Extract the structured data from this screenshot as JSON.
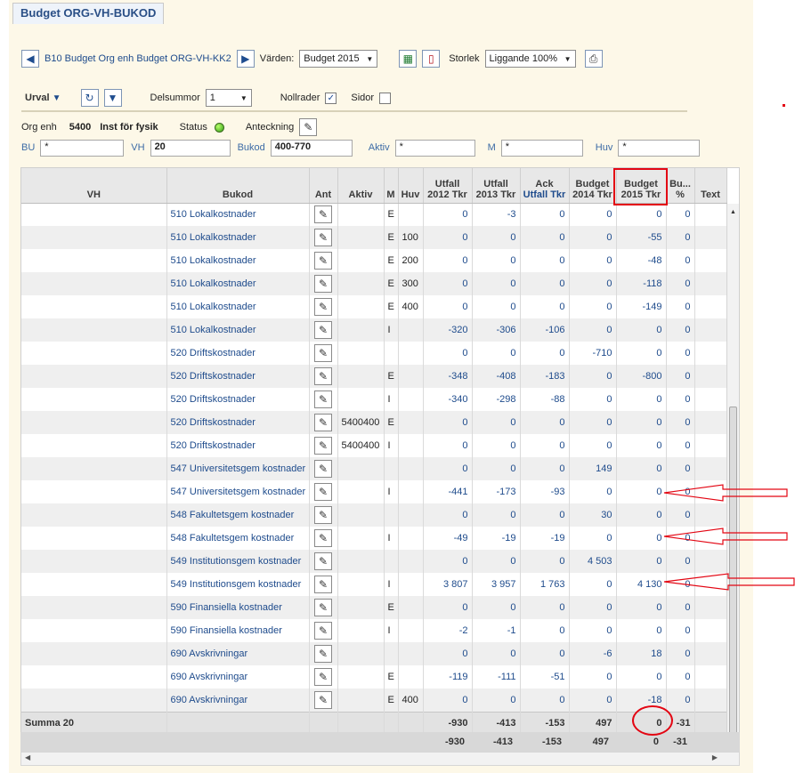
{
  "window": {
    "title": "Budget ORG-VH-BUKOD"
  },
  "toolbar": {
    "breadcrumb": "B10 Budget Org enh  Budget ORG-VH-KK2",
    "values_label": "Värden:",
    "values_selected": "Budget 2015",
    "size_label": "Storlek",
    "size_selected": "Liggande 100%",
    "urval_label": "Urval",
    "delsummor_label": "Delsummor",
    "delsummor_selected": "1",
    "nollrader_label": "Nollrader",
    "nollrader_checked": true,
    "sidor_label": "Sidor",
    "sidor_checked": false
  },
  "filters": {
    "org_enh_label": "Org enh",
    "org_enh_code": "5400",
    "org_enh_name": "Inst för fysik",
    "status_label": "Status",
    "anteckning_label": "Anteckning",
    "bu_label": "BU",
    "bu_value": "*",
    "vh_label": "VH",
    "vh_value": "20",
    "bukod_label": "Bukod",
    "bukod_value": "400-770",
    "aktiv_label": "Aktiv",
    "aktiv_value": "*",
    "m_label": "M",
    "m_value": "*",
    "huv_label": "Huv",
    "huv_value": "*"
  },
  "table": {
    "headers": [
      {
        "top": "",
        "bottom": "VH"
      },
      {
        "top": "",
        "bottom": "Bukod"
      },
      {
        "top": "",
        "bottom": "Ant"
      },
      {
        "top": "",
        "bottom": "Aktiv"
      },
      {
        "top": "",
        "bottom": "M"
      },
      {
        "top": "",
        "bottom": "Huv"
      },
      {
        "top": "Utfall",
        "bottom": "2012 Tkr"
      },
      {
        "top": "Utfall",
        "bottom": "2013 Tkr"
      },
      {
        "top": "Ack",
        "bottom": "Utfall Tkr"
      },
      {
        "top": "Budget",
        "bottom": "2014 Tkr"
      },
      {
        "top": "Budget",
        "bottom": "2015 Tkr"
      },
      {
        "top": "Bu...",
        "bottom": "%"
      },
      {
        "top": "",
        "bottom": "Text"
      }
    ],
    "rows": [
      {
        "bukod": "510 Lokalkostnader",
        "aktiv": "",
        "m": "E",
        "huv": "",
        "u2012": "0",
        "u2013": "-3",
        "ack": "0",
        "b2014": "0",
        "b2015": "0",
        "pct": "0"
      },
      {
        "bukod": "510 Lokalkostnader",
        "aktiv": "",
        "m": "E",
        "huv": "100",
        "u2012": "0",
        "u2013": "0",
        "ack": "0",
        "b2014": "0",
        "b2015": "-55",
        "pct": "0"
      },
      {
        "bukod": "510 Lokalkostnader",
        "aktiv": "",
        "m": "E",
        "huv": "200",
        "u2012": "0",
        "u2013": "0",
        "ack": "0",
        "b2014": "0",
        "b2015": "-48",
        "pct": "0"
      },
      {
        "bukod": "510 Lokalkostnader",
        "aktiv": "",
        "m": "E",
        "huv": "300",
        "u2012": "0",
        "u2013": "0",
        "ack": "0",
        "b2014": "0",
        "b2015": "-118",
        "pct": "0"
      },
      {
        "bukod": "510 Lokalkostnader",
        "aktiv": "",
        "m": "E",
        "huv": "400",
        "u2012": "0",
        "u2013": "0",
        "ack": "0",
        "b2014": "0",
        "b2015": "-149",
        "pct": "0"
      },
      {
        "bukod": "510 Lokalkostnader",
        "aktiv": "",
        "m": "I",
        "huv": "",
        "u2012": "-320",
        "u2013": "-306",
        "ack": "-106",
        "b2014": "0",
        "b2015": "0",
        "pct": "0"
      },
      {
        "bukod": "520 Driftskostnader",
        "aktiv": "",
        "m": "",
        "huv": "",
        "u2012": "0",
        "u2013": "0",
        "ack": "0",
        "b2014": "-710",
        "b2015": "0",
        "pct": "0"
      },
      {
        "bukod": "520 Driftskostnader",
        "aktiv": "",
        "m": "E",
        "huv": "",
        "u2012": "-348",
        "u2013": "-408",
        "ack": "-183",
        "b2014": "0",
        "b2015": "-800",
        "pct": "0"
      },
      {
        "bukod": "520 Driftskostnader",
        "aktiv": "",
        "m": "I",
        "huv": "",
        "u2012": "-340",
        "u2013": "-298",
        "ack": "-88",
        "b2014": "0",
        "b2015": "0",
        "pct": "0"
      },
      {
        "bukod": "520 Driftskostnader",
        "aktiv": "5400400",
        "m": "E",
        "huv": "",
        "u2012": "0",
        "u2013": "0",
        "ack": "0",
        "b2014": "0",
        "b2015": "0",
        "pct": "0"
      },
      {
        "bukod": "520 Driftskostnader",
        "aktiv": "5400400",
        "m": "I",
        "huv": "",
        "u2012": "0",
        "u2013": "0",
        "ack": "0",
        "b2014": "0",
        "b2015": "0",
        "pct": "0"
      },
      {
        "bukod": "547 Universitetsgem kostnader",
        "aktiv": "",
        "m": "",
        "huv": "",
        "u2012": "0",
        "u2013": "0",
        "ack": "0",
        "b2014": "149",
        "b2015": "0",
        "pct": "0"
      },
      {
        "bukod": "547 Universitetsgem kostnader",
        "aktiv": "",
        "m": "I",
        "huv": "",
        "u2012": "-441",
        "u2013": "-173",
        "ack": "-93",
        "b2014": "0",
        "b2015": "0",
        "pct": "0"
      },
      {
        "bukod": "548 Fakultetsgem kostnader",
        "aktiv": "",
        "m": "",
        "huv": "",
        "u2012": "0",
        "u2013": "0",
        "ack": "0",
        "b2014": "30",
        "b2015": "0",
        "pct": "0"
      },
      {
        "bukod": "548 Fakultetsgem kostnader",
        "aktiv": "",
        "m": "I",
        "huv": "",
        "u2012": "-49",
        "u2013": "-19",
        "ack": "-19",
        "b2014": "0",
        "b2015": "0",
        "pct": "0"
      },
      {
        "bukod": "549 Institutionsgem kostnader",
        "aktiv": "",
        "m": "",
        "huv": "",
        "u2012": "0",
        "u2013": "0",
        "ack": "0",
        "b2014": "4 503",
        "b2015": "0",
        "pct": "0"
      },
      {
        "bukod": "549 Institutionsgem kostnader",
        "aktiv": "",
        "m": "I",
        "huv": "",
        "u2012": "3 807",
        "u2013": "3 957",
        "ack": "1 763",
        "b2014": "0",
        "b2015": "4 130",
        "pct": "0"
      },
      {
        "bukod": "590 Finansiella kostnader",
        "aktiv": "",
        "m": "E",
        "huv": "",
        "u2012": "0",
        "u2013": "0",
        "ack": "0",
        "b2014": "0",
        "b2015": "0",
        "pct": "0"
      },
      {
        "bukod": "590 Finansiella kostnader",
        "aktiv": "",
        "m": "I",
        "huv": "",
        "u2012": "-2",
        "u2013": "-1",
        "ack": "0",
        "b2014": "0",
        "b2015": "0",
        "pct": "0"
      },
      {
        "bukod": "690 Avskrivningar",
        "aktiv": "",
        "m": "",
        "huv": "",
        "u2012": "0",
        "u2013": "0",
        "ack": "0",
        "b2014": "-6",
        "b2015": "18",
        "pct": "0"
      },
      {
        "bukod": "690 Avskrivningar",
        "aktiv": "",
        "m": "E",
        "huv": "",
        "u2012": "-119",
        "u2013": "-111",
        "ack": "-51",
        "b2014": "0",
        "b2015": "0",
        "pct": "0"
      },
      {
        "bukod": "690 Avskrivningar",
        "aktiv": "",
        "m": "E",
        "huv": "400",
        "u2012": "0",
        "u2013": "0",
        "ack": "0",
        "b2014": "0",
        "b2015": "-18",
        "pct": "0"
      }
    ],
    "summary": {
      "label": "Summa 20",
      "u2012": "-930",
      "u2013": "-413",
      "ack": "-153",
      "b2014": "497",
      "b2015": "0",
      "pct": "-31"
    },
    "total": {
      "u2012": "-930",
      "u2013": "-413",
      "ack": "-153",
      "b2014": "497",
      "b2015": "0",
      "pct": "-31"
    }
  },
  "colors": {
    "accent": "#1e4b8c",
    "highlight": "#e30613"
  }
}
